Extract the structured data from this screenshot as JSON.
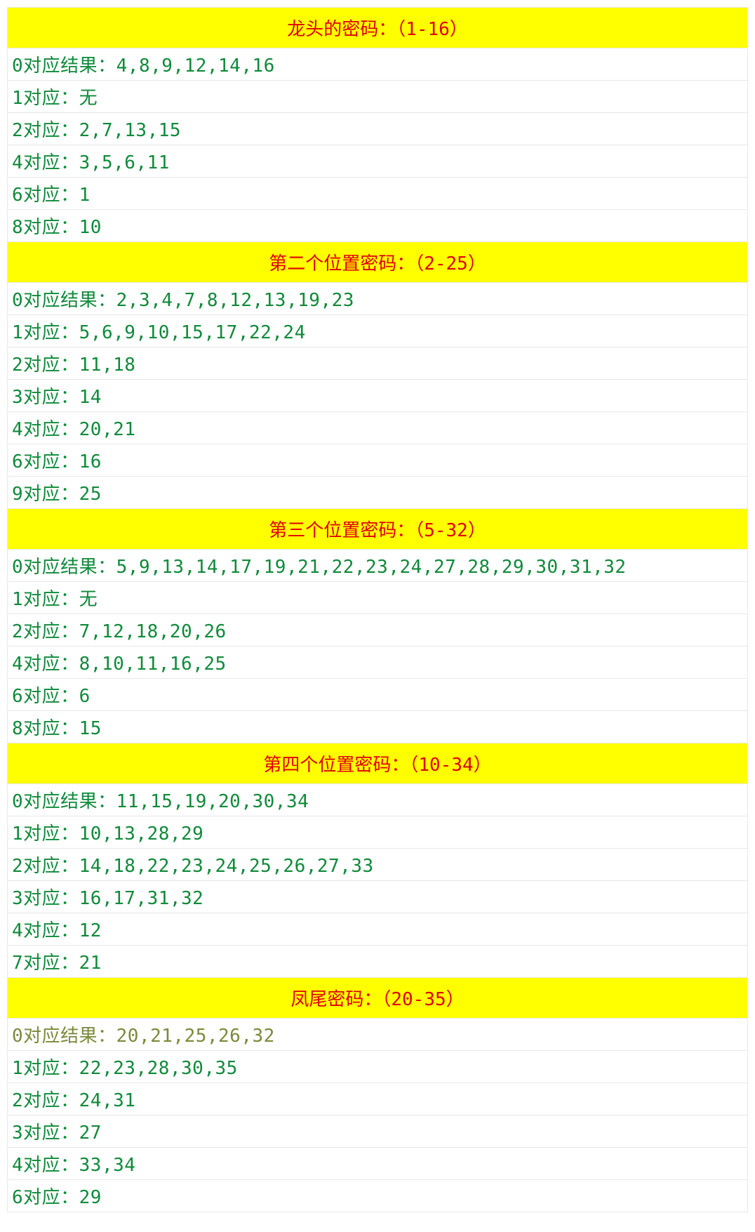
{
  "sections": [
    {
      "title": "龙头的密码：（1-16）",
      "rows": [
        {
          "text": "0对应结果：4,8,9,12,14,16"
        },
        {
          "text": "1对应：无"
        },
        {
          "text": "2对应：2,7,13,15"
        },
        {
          "text": "4对应：3,5,6,11"
        },
        {
          "text": "6对应：1"
        },
        {
          "text": "8对应：10"
        }
      ]
    },
    {
      "title": "第二个位置密码：（2-25）",
      "rows": [
        {
          "text": "0对应结果：2,3,4,7,8,12,13,19,23"
        },
        {
          "text": "1对应：5,6,9,10,15,17,22,24"
        },
        {
          "text": "2对应：11,18"
        },
        {
          "text": "3对应：14"
        },
        {
          "text": "4对应：20,21"
        },
        {
          "text": "6对应：16"
        },
        {
          "text": "9对应：25"
        }
      ]
    },
    {
      "title": "第三个位置密码：（5-32）",
      "rows": [
        {
          "text": "0对应结果：5,9,13,14,17,19,21,22,23,24,27,28,29,30,31,32"
        },
        {
          "text": "1对应：无"
        },
        {
          "text": "2对应：7,12,18,20,26"
        },
        {
          "text": "4对应：8,10,11,16,25"
        },
        {
          "text": "6对应：6"
        },
        {
          "text": "8对应：15"
        }
      ]
    },
    {
      "title": "第四个位置密码：（10-34）",
      "rows": [
        {
          "text": "0对应结果：11,15,19,20,30,34"
        },
        {
          "text": "1对应：10,13,28,29"
        },
        {
          "text": "2对应：14,18,22,23,24,25,26,27,33"
        },
        {
          "text": "3对应：16,17,31,32"
        },
        {
          "text": "4对应：12"
        },
        {
          "text": "7对应：21"
        }
      ]
    },
    {
      "title": "凤尾密码：（20-35）",
      "rows": [
        {
          "text": "0对应结果：20,21,25,26,32",
          "muted": true
        },
        {
          "text": "1对应：22,23,28,30,35"
        },
        {
          "text": "2对应：24,31"
        },
        {
          "text": "3对应：27"
        },
        {
          "text": "4对应：33,34"
        },
        {
          "text": "6对应：29"
        }
      ]
    }
  ]
}
